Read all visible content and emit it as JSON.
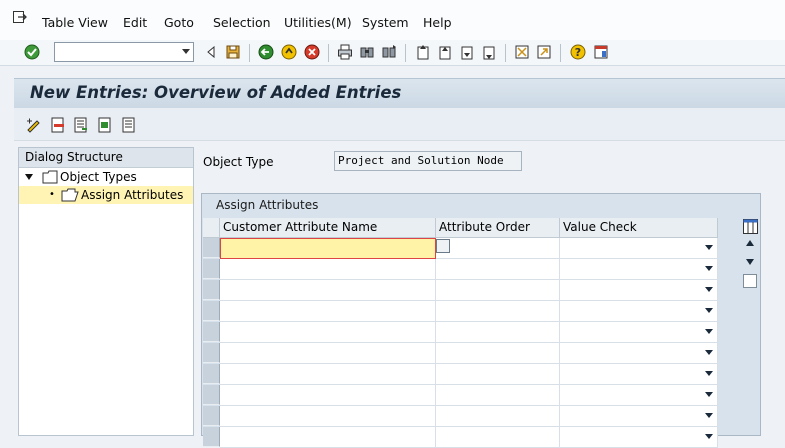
{
  "menu": {
    "items": [
      "Table View",
      "Edit",
      "Goto",
      "Selection",
      "Utilities(M)",
      "System",
      "Help"
    ]
  },
  "toolbar": {
    "command_value": ""
  },
  "title": "New Entries: Overview of Added Entries",
  "tree": {
    "header": "Dialog Structure",
    "items": [
      {
        "label": "Object Types",
        "level": 0,
        "expanded": true
      },
      {
        "label": "Assign Attributes",
        "level": 1,
        "selected": true
      }
    ]
  },
  "object_type": {
    "label": "Object Type",
    "value": "Project and Solution Node"
  },
  "table": {
    "caption": "Assign Attributes",
    "columns": [
      "Customer Attribute Name",
      "Attribute Order",
      "Value Check"
    ],
    "rows": [
      {
        "name": "",
        "order": "",
        "check": ""
      },
      {
        "name": "",
        "order": "",
        "check": ""
      },
      {
        "name": "",
        "order": "",
        "check": ""
      },
      {
        "name": "",
        "order": "",
        "check": ""
      },
      {
        "name": "",
        "order": "",
        "check": ""
      },
      {
        "name": "",
        "order": "",
        "check": ""
      },
      {
        "name": "",
        "order": "",
        "check": ""
      },
      {
        "name": "",
        "order": "",
        "check": ""
      },
      {
        "name": "",
        "order": "",
        "check": ""
      },
      {
        "name": "",
        "order": "",
        "check": ""
      }
    ]
  },
  "colors": {
    "accent": "#1b2a3a",
    "selected_row": "#fff4b3",
    "focus_cell": "#fff3a8"
  }
}
